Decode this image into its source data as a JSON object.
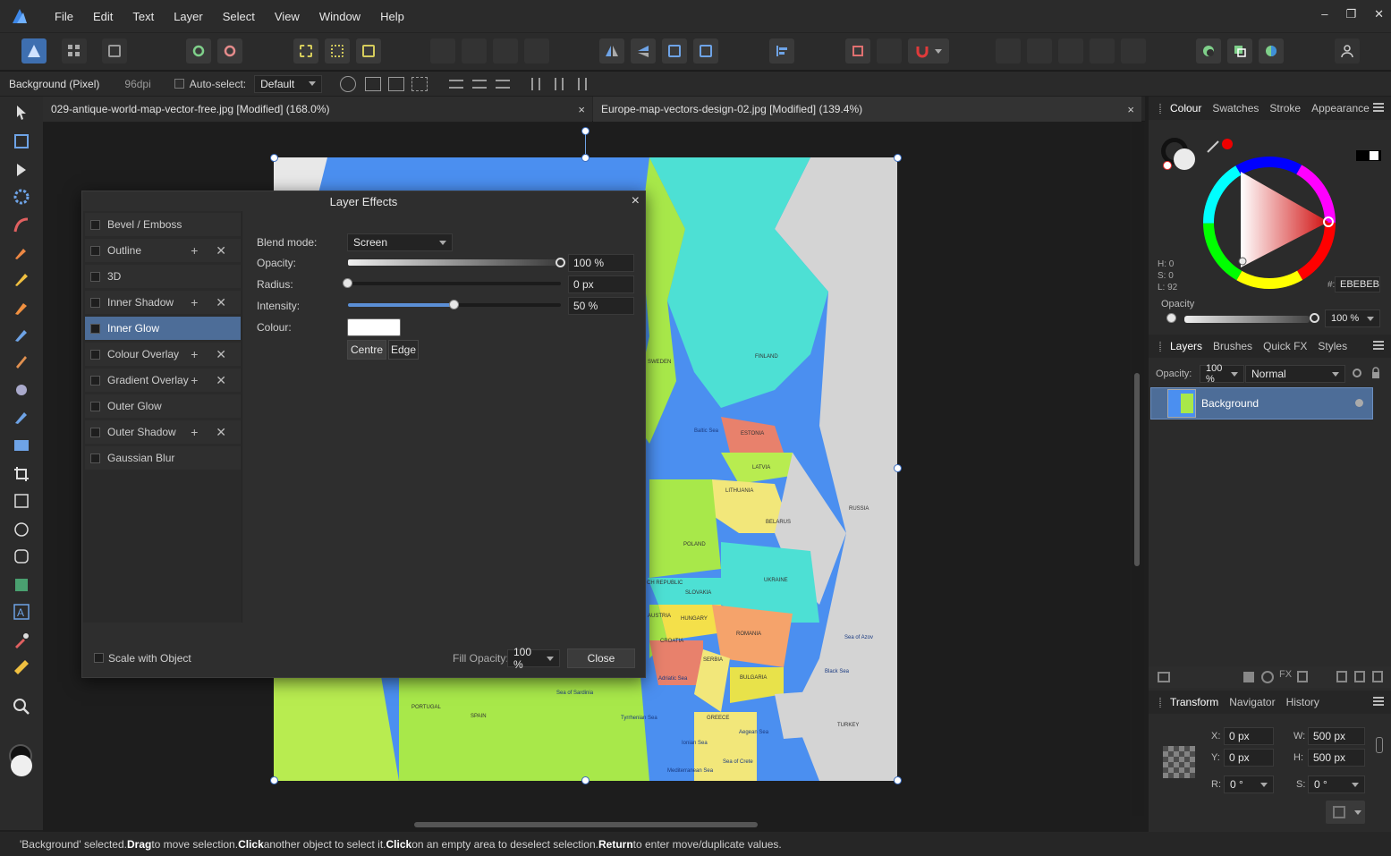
{
  "menu": [
    "File",
    "Edit",
    "Text",
    "Layer",
    "Select",
    "View",
    "Window",
    "Help"
  ],
  "window_controls": [
    "–",
    "❐",
    "✕"
  ],
  "context": {
    "layer_type": "Background (Pixel)",
    "dpi": "96dpi",
    "auto_select_label": "Auto-select:",
    "auto_select_value": "Default"
  },
  "tabs": [
    {
      "label": "029-antique-world-map-vector-free.jpg [Modified] (168.0%)"
    },
    {
      "label": "Europe-map-vectors-design-02.jpg [Modified] (139.4%)"
    }
  ],
  "close_glyph": "×",
  "dialog": {
    "title": "Layer Effects",
    "effects": [
      {
        "label": "Bevel / Emboss",
        "has_pm": false
      },
      {
        "label": "Outline",
        "has_pm": true
      },
      {
        "label": "3D",
        "has_pm": false
      },
      {
        "label": "Inner Shadow",
        "has_pm": true
      },
      {
        "label": "Inner Glow",
        "has_pm": false
      },
      {
        "label": "Colour Overlay",
        "has_pm": true
      },
      {
        "label": "Gradient Overlay",
        "has_pm": true
      },
      {
        "label": "Outer Glow",
        "has_pm": false
      },
      {
        "label": "Outer Shadow",
        "has_pm": true
      },
      {
        "label": "Gaussian Blur",
        "has_pm": false
      }
    ],
    "plus_minus": "+ ✕",
    "selected_effect": "Inner Glow",
    "blend_mode_label": "Blend mode:",
    "blend_mode_value": "Screen",
    "opacity_label": "Opacity:",
    "opacity_value": "100 %",
    "opacity_level": 1.0,
    "radius_label": "Radius:",
    "radius_value": "0 px",
    "radius_level": 0.0,
    "intensity_label": "Intensity:",
    "intensity_value": "50 %",
    "intensity_level": 0.5,
    "colour_label": "Colour:",
    "colour_value": "#ffffff",
    "centre_label": "Centre",
    "edge_label": "Edge",
    "scale_label": "Scale with Object",
    "fill_opacity_label": "Fill Opacity:",
    "fill_opacity_value": "100 %",
    "close_label": "Close"
  },
  "colour_panel": {
    "tabs": [
      "Colour",
      "Swatches",
      "Stroke",
      "Appearance"
    ],
    "h": "H: 0",
    "s": "S: 0",
    "l": "L: 92",
    "hex_label": "#:",
    "hex_value": "EBEBEB",
    "opacity_label": "Opacity",
    "opacity_value": "100 %"
  },
  "layers_panel": {
    "tabs": [
      "Layers",
      "Brushes",
      "Quick FX",
      "Styles"
    ],
    "opacity_label": "Opacity:",
    "opacity_value": "100 %",
    "blend_value": "Normal",
    "layer_name": "Background"
  },
  "transform_panel": {
    "tabs": [
      "Transform",
      "Navigator",
      "History"
    ],
    "x_label": "X:",
    "x_value": "0 px",
    "y_label": "Y:",
    "y_value": "0 px",
    "w_label": "W:",
    "w_value": "500 px",
    "h_label": "H:",
    "h_value": "500 px",
    "r_label": "R:",
    "r_value": "0 °",
    "s_label": "S:",
    "s_value": "0 °"
  },
  "map_labels": [
    "FINLAND",
    "ESTONIA",
    "LATVIA",
    "LITHUANIA",
    "BELARUS",
    "POLAND",
    "RUSSIA",
    "UKRAINE",
    "SLOVAKIA",
    "HUNGARY",
    "ROMANIA",
    "CROATIA",
    "SERBIA",
    "BULGARIA",
    "GREECE",
    "TURKEY",
    "PORTUGAL",
    "SPAIN",
    "SWEDEN",
    "CH REPUBLIC",
    "AUSTRIA",
    "Baltic Sea",
    "Black Sea",
    "Sea of Azov",
    "Adriatic Sea",
    "Aegean Sea",
    "Mediterranean Sea",
    "Tyrrhenian Sea",
    "Ionian Sea",
    "Sea of Crete",
    "Sea of Sardinia"
  ],
  "status": {
    "p1": "'Background' selected. ",
    "b1": "Drag",
    "p2": " to move selection. ",
    "b2": "Click",
    "p3": " another object to select it. ",
    "b3": "Click",
    "p4": " on an empty area to deselect selection. ",
    "b4": "Return",
    "p5": " to enter move/duplicate values."
  }
}
